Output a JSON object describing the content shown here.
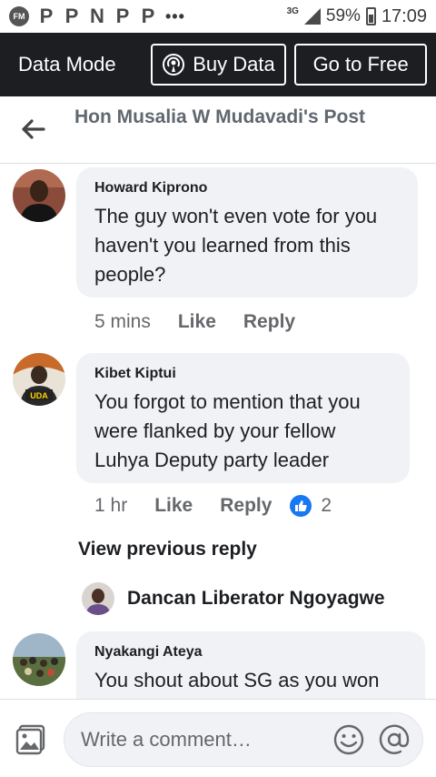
{
  "status_bar": {
    "fm_badge": "FM",
    "app_letters": [
      "P",
      "P",
      "N",
      "P",
      "P"
    ],
    "more": "•••",
    "network": "3G",
    "battery": "59%",
    "time": "17:09",
    "icons": [
      "fm-radio-icon",
      "p-icon",
      "n-icon",
      "signal-icon",
      "battery-icon"
    ]
  },
  "data_bar": {
    "mode_label": "Data Mode",
    "buy_label": "Buy Data",
    "free_label": "Go to Free"
  },
  "header": {
    "title": "Hon Musalia W Mudavadi's Post"
  },
  "comments": [
    {
      "author": "Howard Kiprono",
      "text": "The guy won't even vote for you haven't you learned from this people?",
      "time": "5 mins",
      "like_label": "Like",
      "reply_label": "Reply"
    },
    {
      "author": "Kibet Kiptui",
      "text": "You forgot to mention that you were flanked by your fellow Luhya Deputy party leader",
      "time": "1 hr",
      "like_label": "Like",
      "reply_label": "Reply",
      "reaction_count": "2",
      "avatar_badge": "UDA"
    },
    {
      "author": "Nyakangi Ateya",
      "text": "You shout about SG as you won"
    }
  ],
  "view_previous_reply": "View previous reply",
  "reply_preview": {
    "name": "Dancan Liberator Ngoyagwe"
  },
  "composer": {
    "placeholder": "Write a comment…"
  },
  "colors": {
    "data_bar_bg": "#1c1e21",
    "bubble_bg": "#f0f2f5",
    "like_blue": "#1877f2",
    "muted_text": "#65676b"
  }
}
